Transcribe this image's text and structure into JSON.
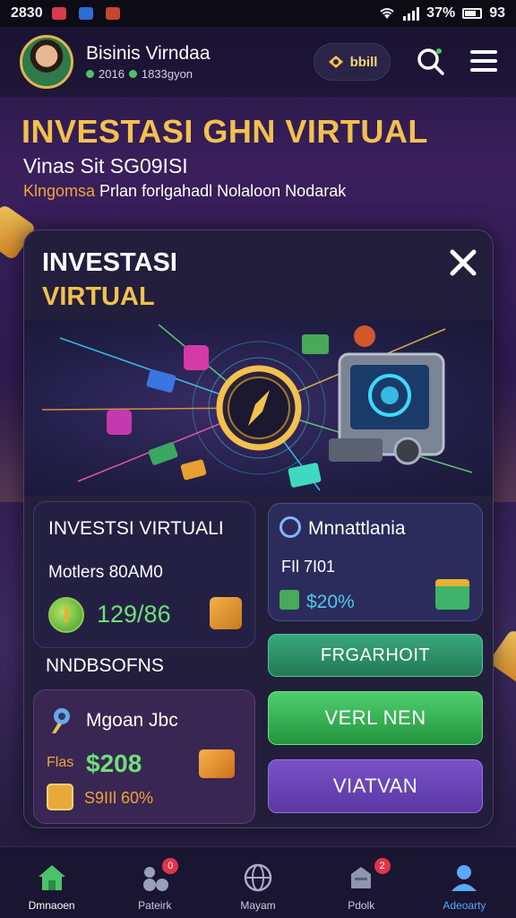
{
  "status_bar": {
    "time": "2830",
    "battery": "37%",
    "signal_extra": "93"
  },
  "header": {
    "user_name": "Bisinis Virndaa",
    "user_sub_a": "2016",
    "user_sub_b": "1833gyon",
    "pill_label": "bbill"
  },
  "hero": {
    "title": "INVESTASI GHN VIRTUAL",
    "subtitle": "Vinas Sit SG09ISI",
    "tagline_accent": "Klngomsa",
    "tagline_rest": " Prlan forlgahadl Nolaloon Nodarak"
  },
  "modal": {
    "title_line1": "INVESTASI",
    "title_line2": "VIRTUAL",
    "invest_card": {
      "title": "INVESTSI VIRTUALI",
      "subtitle": "Motlers 80AM0",
      "value": "129/86"
    },
    "section_label": "NNDBSOFNS",
    "mgoan_card": {
      "title": "Mgoan Jbc",
      "label": "Flas",
      "value": "$208",
      "percent": "S9IIl 60%"
    },
    "mnat_card": {
      "title": "Mnnattlania",
      "subtitle": "FIl 7I01",
      "value": "$20%"
    },
    "buttons": {
      "primary": "FRGARHOIT",
      "secondary": "VERL NEN",
      "tertiary": "VIATVAN"
    }
  },
  "bottom_nav": {
    "items": [
      {
        "label": "Dmnaoen",
        "icon": "home-icon"
      },
      {
        "label": "Pateirk",
        "icon": "people-icon",
        "badge": "0"
      },
      {
        "label": "Mayam",
        "icon": "globe-icon"
      },
      {
        "label": "Pdolk",
        "icon": "inbox-icon",
        "badge": "2"
      },
      {
        "label": "Adeoarty",
        "icon": "profile-icon"
      }
    ]
  },
  "colors": {
    "accent_gold": "#f2c14e",
    "accent_green": "#6fe07a",
    "accent_blue": "#59a9ff"
  }
}
